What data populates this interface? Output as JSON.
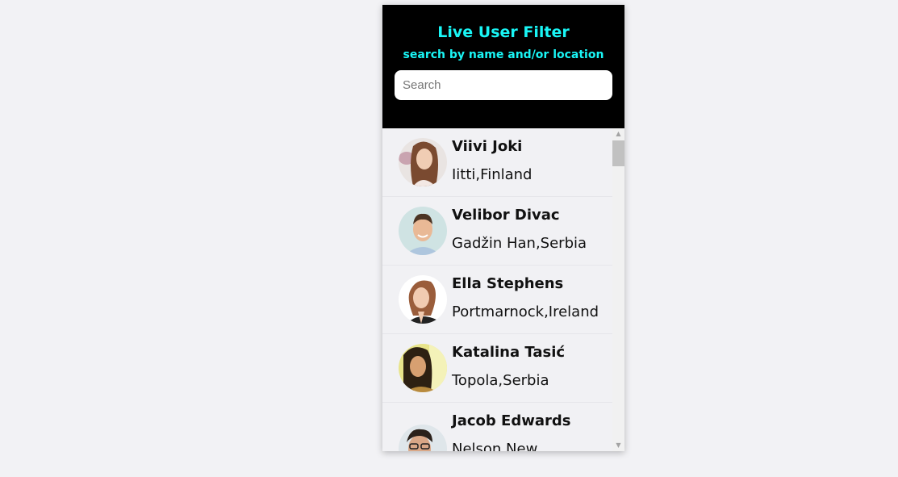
{
  "header": {
    "title": "Live User Filter",
    "subtitle": "search by name and/or location",
    "search_placeholder": "Search",
    "search_value": "",
    "bg_color": "#000000",
    "accent_color": "#19f5f5"
  },
  "users": [
    {
      "name": "Viivi Joki",
      "location": "Iitti,Finland",
      "avatar": "woman-brown-hair-photo"
    },
    {
      "name": "Velibor Divac",
      "location": "Gadžin Han,Serbia",
      "avatar": "man-smiling-photo"
    },
    {
      "name": "Ella Stephens",
      "location": "Portmarnock,Ireland",
      "avatar": "woman-red-hair-photo"
    },
    {
      "name": "Katalina Tasić",
      "location": "Topola,Serbia",
      "avatar": "woman-dark-hair-photo"
    },
    {
      "name": "Jacob Edwards",
      "location": "Nelson,New",
      "avatar": "man-glasses-photo"
    }
  ],
  "scrollbar": {
    "up_icon": "chevron-up-icon",
    "down_icon": "chevron-down-icon"
  }
}
